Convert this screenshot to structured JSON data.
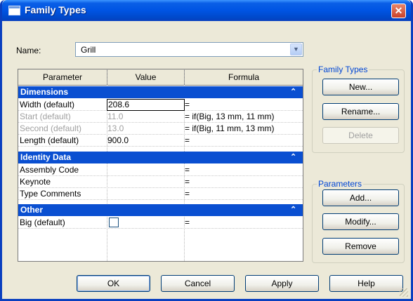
{
  "window": {
    "title": "Family Types",
    "close_glyph": "✕"
  },
  "name_field": {
    "label": "Name:",
    "value": "Grill"
  },
  "table": {
    "columns": [
      "Parameter",
      "Value",
      "Formula"
    ],
    "groups": [
      {
        "title": "Dimensions",
        "rows": [
          {
            "parameter": "Width (default)",
            "value": "208.6",
            "formula": "="
          },
          {
            "parameter": "Start (default)",
            "value": "11.0",
            "formula": "= if(Big, 13 mm, 11 mm)"
          },
          {
            "parameter": "Second (default)",
            "value": "13.0",
            "formula": "= if(Big, 11 mm, 13 mm)"
          },
          {
            "parameter": "Length (default)",
            "value": "900.0",
            "formula": "="
          }
        ]
      },
      {
        "title": "Identity Data",
        "rows": [
          {
            "parameter": "Assembly Code",
            "value": "",
            "formula": "="
          },
          {
            "parameter": "Keynote",
            "value": "",
            "formula": "="
          },
          {
            "parameter": "Type Comments",
            "value": "",
            "formula": "="
          }
        ]
      },
      {
        "title": "Other",
        "rows": [
          {
            "parameter": "Big (default)",
            "value": "",
            "formula": "="
          }
        ]
      }
    ],
    "collapse_glyph": "⌃"
  },
  "family_types_group": {
    "title": "Family Types",
    "new_label": "New...",
    "rename_label": "Rename...",
    "delete_label": "Delete"
  },
  "parameters_group": {
    "title": "Parameters",
    "add_label": "Add...",
    "modify_label": "Modify...",
    "remove_label": "Remove"
  },
  "footer": {
    "ok": "OK",
    "cancel": "Cancel",
    "apply": "Apply",
    "help": "Help"
  },
  "colors": {
    "titlebar": "#0054e3",
    "group_header": "#0a4fd1",
    "groupbox_title": "#0046d5",
    "dialog_bg": "#ece9d8"
  }
}
